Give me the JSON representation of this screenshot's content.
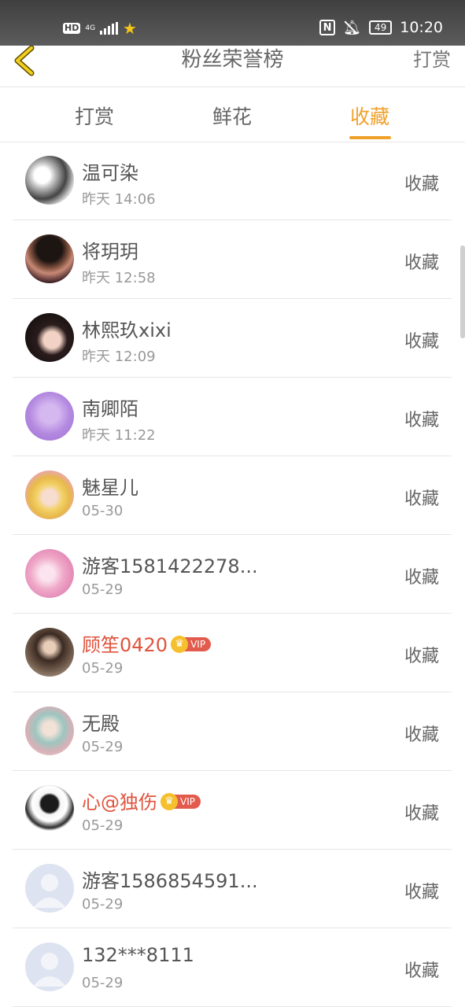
{
  "status_bar": {
    "hd": "HD",
    "network": "4G",
    "battery": "49",
    "time": "10:20"
  },
  "header": {
    "title": "粉丝荣誉榜",
    "right_action": "打赏"
  },
  "tabs": [
    {
      "label": "打赏",
      "active": false
    },
    {
      "label": "鲜花",
      "active": false
    },
    {
      "label": "收藏",
      "active": true
    }
  ],
  "colors": {
    "accent": "#f0a12b",
    "vip_name": "#e0533d"
  },
  "fans": [
    {
      "name": "温可染",
      "time": "昨天 14:06",
      "action": "收藏",
      "vip": false,
      "avatar": "photo-grayscale"
    },
    {
      "name": "将玥玥",
      "time": "昨天 12:58",
      "action": "收藏",
      "vip": false,
      "avatar": "photo-person"
    },
    {
      "name": "林熙玖xixi",
      "time": "昨天 12:09",
      "action": "收藏",
      "vip": false,
      "avatar": "photo-girl"
    },
    {
      "name": "南卿陌",
      "time": "昨天 11:22",
      "action": "收藏",
      "vip": false,
      "avatar": "photo-purple"
    },
    {
      "name": "魅星儿",
      "time": "05-30",
      "action": "收藏",
      "vip": false,
      "avatar": "anime-yellow-hair"
    },
    {
      "name": "游客1581422278...",
      "time": "05-29",
      "action": "收藏",
      "vip": false,
      "avatar": "anime-pink"
    },
    {
      "name": "顾笙0420",
      "time": "05-29",
      "action": "收藏",
      "vip": true,
      "vip_label": "VIP",
      "avatar": "photo-girl-dark"
    },
    {
      "name": "无殿",
      "time": "05-29",
      "action": "收藏",
      "vip": false,
      "avatar": "anime-teal"
    },
    {
      "name": "心@独伤",
      "time": "05-29",
      "action": "收藏",
      "vip": true,
      "vip_label": "VIP",
      "avatar": "anime-boy"
    },
    {
      "name": "游客1586854591...",
      "time": "05-29",
      "action": "收藏",
      "vip": false,
      "avatar": "default-user"
    },
    {
      "name": "132***8111",
      "time": "05-29",
      "action": "收藏",
      "vip": false,
      "avatar": "default-user"
    }
  ]
}
